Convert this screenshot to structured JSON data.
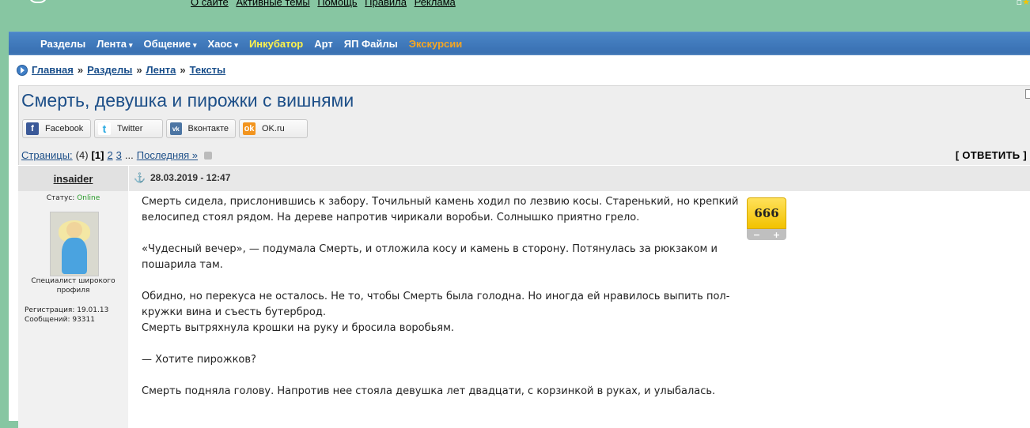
{
  "top_links": [
    "О сайте",
    "Активные темы",
    "Помощь",
    "Правила",
    "Реклама"
  ],
  "nav": {
    "items": [
      {
        "label": "Разделы",
        "dropdown": false,
        "color": "#ffffff"
      },
      {
        "label": "Лента",
        "dropdown": true,
        "color": "#ffffff"
      },
      {
        "label": "Общение",
        "dropdown": true,
        "color": "#ffffff"
      },
      {
        "label": "Хаос",
        "dropdown": true,
        "color": "#ffffff"
      },
      {
        "label": "Инкубатор",
        "dropdown": false,
        "color": "#fff34a"
      },
      {
        "label": "Арт",
        "dropdown": false,
        "color": "#ffffff"
      },
      {
        "label": "ЯП Файлы",
        "dropdown": false,
        "color": "#ffffff"
      },
      {
        "label": "Экскурсии",
        "dropdown": false,
        "color": "#f5a623"
      }
    ],
    "caret": "▾"
  },
  "breadcrumb": {
    "items": [
      "Главная",
      "Разделы",
      "Лента",
      "Тексты"
    ],
    "separator": "»"
  },
  "topic": {
    "title": "Смерть, девушка и пирожки с вишнями"
  },
  "share": {
    "buttons": [
      {
        "label": "Facebook",
        "icon": "facebook-icon",
        "glyph": "f"
      },
      {
        "label": "Twitter",
        "icon": "twitter-icon",
        "glyph": "t"
      },
      {
        "label": "Вконтакте",
        "icon": "vk-icon",
        "glyph": "vk"
      },
      {
        "label": "OK.ru",
        "icon": "ok-icon",
        "glyph": "ok"
      }
    ]
  },
  "pagination": {
    "label": "Страницы:",
    "count": "(4)",
    "current": "[1]",
    "pages": [
      "2",
      "3"
    ],
    "ellipsis": "...",
    "last": "Последняя »",
    "reply": "[ ОТВЕТИТЬ ]"
  },
  "post": {
    "author": "insaider",
    "anchor": "⚓",
    "date": "28.03.2019 - 12:47",
    "status_label": "Статус:",
    "status_value": "Online",
    "rank": "Специалист широкого профиля",
    "registration": "Регистрация: 19.01.13",
    "messages": "Сообщений: 93311",
    "rating": "666",
    "rating_minus": "−",
    "rating_plus": "+",
    "paragraphs": [
      "Смерть сидела, прислонившись к забору. Точильный камень ходил по лезвию косы. Старенький, но крепкий велосипед стоял рядом. На дереве напротив чирикали воробьи. Солнышко приятно грело.",
      "«Чудесный вечер», — подумала Смерть, и отложила косу и камень в сторону. Потянулась за рюкзаком и пошарила там.",
      "Обидно, но перекуса не осталось. Не то, чтобы Смерть была голодна. Но иногда ей нравилось выпить пол-кружки вина и съесть бутерброд.\nСмерть вытряхнула крошки на руку и бросила воробьям.",
      "— Хотите пирожков?",
      "Смерть подняла голову. Напротив нее стояла девушка лет двадцати, с корзинкой в руках, и улыбалась."
    ]
  }
}
